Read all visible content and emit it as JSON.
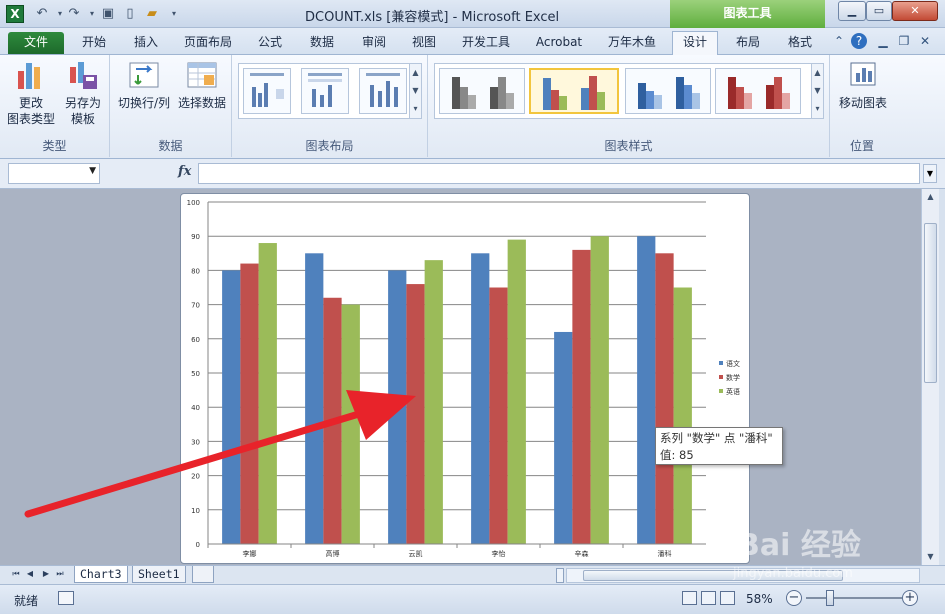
{
  "window": {
    "title": "DCOUNT.xls  [兼容模式] - Microsoft Excel",
    "context_tab": "图表工具",
    "app_icon": "X"
  },
  "tabs": [
    "文件",
    "开始",
    "插入",
    "页面布局",
    "公式",
    "数据",
    "审阅",
    "视图",
    "开发工具",
    "Acrobat",
    "万年木鱼",
    "设计",
    "布局",
    "格式"
  ],
  "ribbon": {
    "type_group": {
      "label": "类型",
      "change_type": "更改\n图表类型",
      "save_template": "另存为\n模板"
    },
    "data_group": {
      "label": "数据",
      "switch_row_col": "切换行/列",
      "select_data": "选择数据"
    },
    "layout_group": {
      "label": "图表布局"
    },
    "style_group": {
      "label": "图表样式"
    },
    "location_group": {
      "label": "位置",
      "move_chart": "移动图表"
    }
  },
  "formula_bar": {
    "fx": "fx",
    "name_box": "",
    "value": ""
  },
  "chart_data": {
    "type": "bar",
    "categories": [
      "李娜",
      "高博",
      "云凯",
      "李怡",
      "辛森",
      "潘科"
    ],
    "series": [
      {
        "name": "语文",
        "values": [
          80,
          85,
          80,
          85,
          62,
          90
        ],
        "color": "#4f81bd"
      },
      {
        "name": "数学",
        "values": [
          82,
          72,
          76,
          75,
          86,
          85
        ],
        "color": "#c0504d"
      },
      {
        "name": "英语",
        "values": [
          88,
          70,
          83,
          89,
          90,
          75
        ],
        "color": "#9bbb59"
      }
    ],
    "ylim": [
      0,
      100
    ],
    "yticks": [
      0,
      10,
      20,
      30,
      40,
      50,
      60,
      70,
      80,
      90,
      100
    ],
    "grid": true,
    "legend": "right"
  },
  "tooltip": {
    "line1": "系列 \"数学\" 点 \"潘科\"",
    "line2": "值: 85"
  },
  "sheets": [
    "Chart3",
    "Sheet1"
  ],
  "status": {
    "ready": "就绪",
    "zoom": "58%"
  },
  "watermark": {
    "logo": "Bai 经验",
    "url": "jingyan.baidu.com"
  },
  "colors": {
    "accent_arrow": "#e8232a",
    "chart_tools_green": "#5fae3e"
  }
}
